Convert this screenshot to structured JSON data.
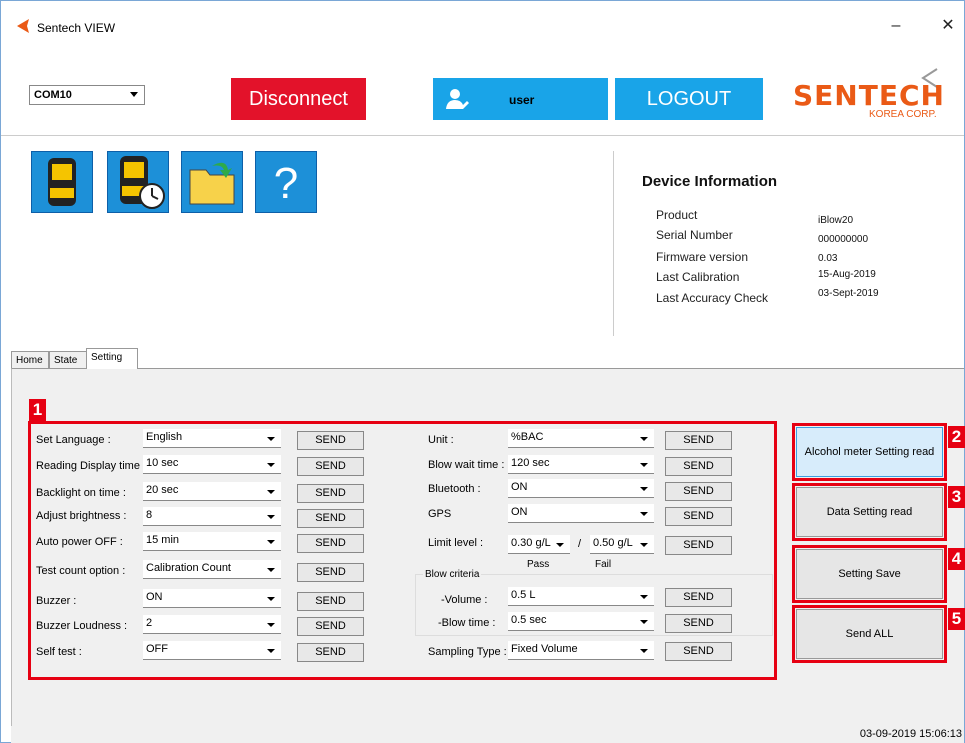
{
  "window": {
    "title": "Sentech VIEW",
    "minimize": "–",
    "close": "✕"
  },
  "header": {
    "com_port": "COM10",
    "disconnect_label": "Disconnect",
    "user_label": "user",
    "logout_label": "LOGOUT",
    "logo_brand": "SENTECH",
    "logo_sub": "KOREA CORP.",
    "brand_color": "#ea5a16",
    "accent_color": "#19a4e8",
    "disconnect_color": "#e3122a"
  },
  "toolbar": {
    "icons": [
      "device-icon",
      "device-history-icon",
      "folder-export-icon",
      "help-icon"
    ],
    "help_glyph": "?"
  },
  "device_info": {
    "title": "Device Information",
    "rows": [
      {
        "label": "Product",
        "value": "iBlow20"
      },
      {
        "label": "Serial Number",
        "value": "000000000"
      },
      {
        "label": "Firmware version",
        "value": "0.03"
      },
      {
        "label": "Last Calibration",
        "value": "15-Aug-2019"
      },
      {
        "label": "Last Accuracy Check",
        "value": "03-Sept-2019"
      }
    ]
  },
  "tabs": [
    {
      "label": "Home"
    },
    {
      "label": "State"
    },
    {
      "label": "Setting"
    }
  ],
  "active_tab": "Setting",
  "markers": [
    "1",
    "2",
    "3",
    "4",
    "5"
  ],
  "settings_left": [
    {
      "label": "Set Language :",
      "value": "English",
      "send": "SEND"
    },
    {
      "label": "Reading Display time :",
      "value": "10 sec",
      "send": "SEND"
    },
    {
      "label": "Backlight on time :",
      "value": "20 sec",
      "send": "SEND"
    },
    {
      "label": "Adjust brightness :",
      "value": "8",
      "send": "SEND"
    },
    {
      "label": "Auto power OFF :",
      "value": "15 min",
      "send": "SEND"
    },
    {
      "label": "Test count option :",
      "value": "Calibration Count",
      "send": "SEND"
    },
    {
      "label": "Buzzer :",
      "value": "ON",
      "send": "SEND"
    },
    {
      "label": "Buzzer Loudness :",
      "value": "2",
      "send": "SEND"
    },
    {
      "label": "Self test :",
      "value": "OFF",
      "send": "SEND"
    }
  ],
  "settings_right": {
    "unit": {
      "label": "Unit :",
      "value": "%BAC",
      "send": "SEND"
    },
    "blow_wait": {
      "label": "Blow wait time :",
      "value": "120 sec",
      "send": "SEND"
    },
    "bluetooth": {
      "label": "Bluetooth :",
      "value": "ON",
      "send": "SEND"
    },
    "gps": {
      "label": "GPS",
      "value": "ON",
      "send": "SEND"
    },
    "limit": {
      "label": "Limit level :",
      "pass_value": "0.30 g/L",
      "fail_value": "0.50 g/L",
      "separator": "/",
      "pass_label": "Pass",
      "fail_label": "Fail",
      "send": "SEND"
    },
    "blow_criteria": {
      "title": "Blow criteria",
      "volume_label": "-Volume :",
      "volume_value": "0.5 L",
      "blowtime_label": "-Blow time :",
      "blowtime_value": "0.5 sec",
      "send": "SEND"
    },
    "sampling": {
      "label": "Sampling Type :",
      "value": "Fixed Volume",
      "send": "SEND"
    }
  },
  "side_buttons": [
    {
      "label": "Alcohol meter Setting read"
    },
    {
      "label": "Data Setting read"
    },
    {
      "label": "Setting Save"
    },
    {
      "label": "Send ALL"
    }
  ],
  "status": {
    "timestamp": "03-09-2019 15:06:13"
  }
}
